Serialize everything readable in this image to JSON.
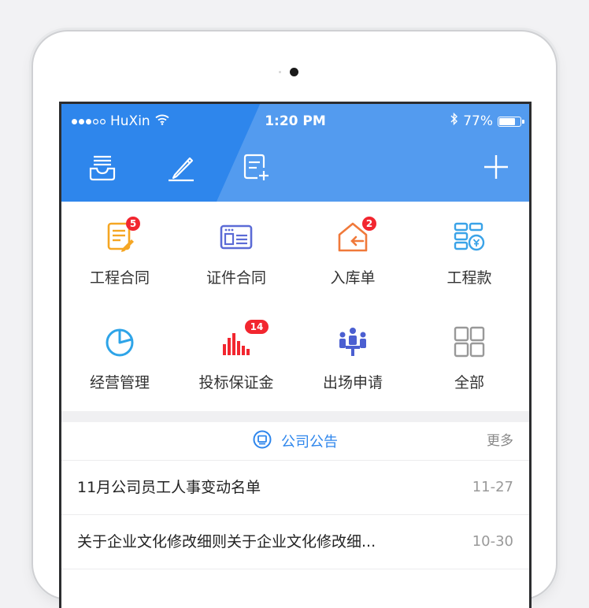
{
  "status_bar": {
    "carrier": "HuXin",
    "time": "1:20 PM",
    "battery": "77%",
    "battery_level": 0.77,
    "signal_bars": 3,
    "signal_total": 5,
    "icons": [
      "wifi-icon",
      "bluetooth-icon",
      "battery-icon"
    ]
  },
  "toolbar": {
    "icons": [
      "inbox-icon",
      "pencil-icon",
      "new-document-icon",
      "plus-icon"
    ]
  },
  "apps": [
    {
      "label": "工程合同",
      "icon": "contract-document-icon",
      "badge": "5",
      "color": "#f5a623"
    },
    {
      "label": "证件合同",
      "icon": "certificate-card-icon",
      "badge": "",
      "color": "#5b6bd6"
    },
    {
      "label": "入库单",
      "icon": "warehouse-entry-icon",
      "badge": "2",
      "color": "#f0793a"
    },
    {
      "label": "工程款",
      "icon": "payment-bricks-icon",
      "badge": "",
      "color": "#3aa3e8"
    },
    {
      "label": "经营管理",
      "icon": "pie-chart-icon",
      "badge": "",
      "color": "#2ea4e8"
    },
    {
      "label": "投标保证金",
      "icon": "bar-chart-icon",
      "badge": "14",
      "color": "#f2262f"
    },
    {
      "label": "出场申请",
      "icon": "meeting-people-icon",
      "badge": "",
      "color": "#4b5fd1"
    },
    {
      "label": "全部",
      "icon": "grid-all-icon",
      "badge": "",
      "color": "#999999"
    }
  ],
  "notices": {
    "title": "公司公告",
    "more": "更多",
    "items": [
      {
        "title": "11月公司员工人事变动名单",
        "date": "11-27"
      },
      {
        "title": "关于企业文化修改细则关于企业文化修改细...",
        "date": "10-30"
      }
    ]
  },
  "colors": {
    "primary": "#2e86ec",
    "badge": "#f2262f"
  }
}
